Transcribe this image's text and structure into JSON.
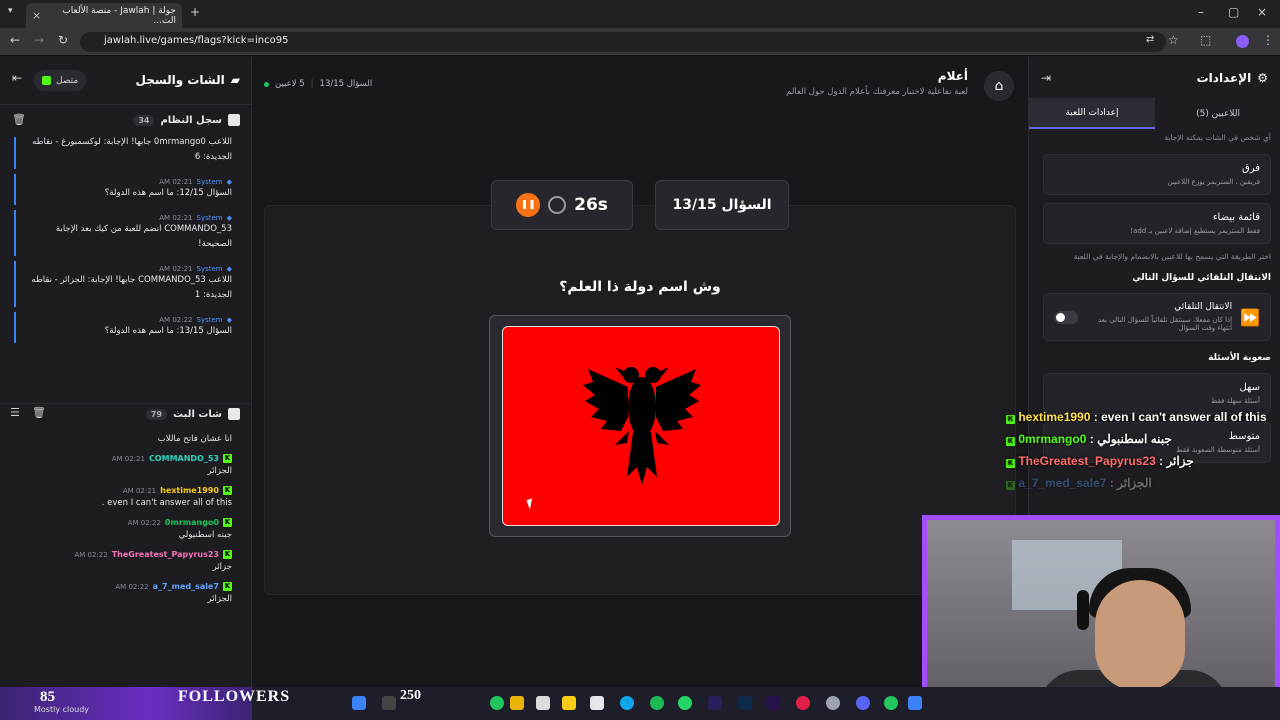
{
  "browser": {
    "tab_title": "جولة | Jawlah - منصة الألعاب الت...",
    "url": "jawlah.live/games/flags?kick=inco95"
  },
  "left_panel": {
    "title": "الشات والسجل",
    "status": "متصل",
    "system_log": {
      "title": "سجل النظام",
      "count": "34",
      "messages": [
        {
          "who": "",
          "time": "",
          "text": "اللاعب 0mrmango0 جابها! الإجابة: لوكسمبورغ - نقاطه الجديدة: 6"
        },
        {
          "who": "System",
          "time": "02:21 AM",
          "text": "السؤال 12/15: ما اسم هذه الدولة؟"
        },
        {
          "who": "System",
          "time": "02:21 AM",
          "text": "COMMANDO_53 انضم للعبة من كيك بعد الإجابة الصحيحة!"
        },
        {
          "who": "System",
          "time": "02:21 AM",
          "text": "اللاعب COMMANDO_53 جابها! الإجابة: الجزائر - نقاطه الجديدة: 1"
        },
        {
          "who": "System",
          "time": "02:22 AM",
          "text": "السؤال 13/15: ما اسم هذه الدولة؟"
        }
      ]
    },
    "stream_chat": {
      "title": "شات البث",
      "count": "79",
      "messages": [
        {
          "user": "",
          "time": "",
          "text": "انا عشان فاتح ماللاب",
          "color": "#e6e6ea"
        },
        {
          "user": "COMMANDO_53",
          "time": "02:21 AM",
          "text": "الجزائر",
          "color": "#2dd4bf"
        },
        {
          "user": "hextime1990",
          "time": "02:21 AM",
          "text": "even I can't answer all of this .",
          "color": "#facc15"
        },
        {
          "user": "0mrmango0",
          "time": "02:22 AM",
          "text": "جبنه اسطنبولي",
          "color": "#22c55e"
        },
        {
          "user": "TheGreatest_Papyrus23",
          "time": "02:22 AM",
          "text": "جزائر",
          "color": "#f472b6"
        },
        {
          "user": "a_7_med_sale7",
          "time": "02:22 AM",
          "text": "الجزائر",
          "color": "#60a5fa"
        }
      ]
    }
  },
  "center": {
    "game_title": "أعلام",
    "game_subtitle": "لعبة تفاعلية لاختبار معرفتك بأعلام الدول حول العالم",
    "players_count": "5 لاعبين",
    "progress": "السؤال 13/15",
    "timer": "26s",
    "question_label": "السؤال 13/15",
    "question_text": "وش اسم دولة ذا العلم؟"
  },
  "right_panel": {
    "title": "الإعدادات",
    "tabs": [
      "اللاعبين (5)",
      "إعدادات اللعبة"
    ],
    "top_note": "أي شخص في الشات يمكنه الإجابة",
    "options": [
      {
        "title": "فرق",
        "desc": "فريقين ، الستريمر يوزع اللاعبين"
      },
      {
        "title": "قائمة بيضاء",
        "desc": "فقط الستريمر يستطيع إضافة لاعبين بـ add!"
      }
    ],
    "join_note": "اختر الطريقة التي يسمح بها للاعبين بالانضمام والإجابة في اللعبة",
    "auto_section": "الانتقال التلقائي للسؤال التالي",
    "auto_title": "الانتقال التلقائي",
    "auto_desc": "إذا كان مفعلا، سينتقل تلقائياً للسؤال التالي بعد انتهاء وقت السؤال",
    "difficulty_section": "صعوبة الأسئلة",
    "difficulty_options": [
      {
        "title": "سهل",
        "desc": "أسئلة سهلة فقط"
      },
      {
        "title": "متوسط",
        "desc": "أسئلة متوسطة الصعوبة فقط"
      }
    ]
  },
  "overlay_chat": [
    {
      "user": "hextime1990",
      "text": ": even I can't answer all of this"
    },
    {
      "user": "0mrmango0",
      "text": ": جبنه اسطنبولي"
    },
    {
      "user": "TheGreatest_Papyrus23",
      "text": ": جزائر"
    },
    {
      "user": "a_7_med_sale7",
      "text": ": الجزائر"
    }
  ],
  "taskbar": {
    "followers_count": "85",
    "weather": "Mostly cloudy",
    "followers_label": "FOLLOWERS",
    "goal": "250"
  },
  "colors": {
    "accent": "#6366f1",
    "kick_green": "#53fc18",
    "timer_orange": "#f97316",
    "flag_red": "#ff0000",
    "webcam_border": "#a24dff"
  }
}
